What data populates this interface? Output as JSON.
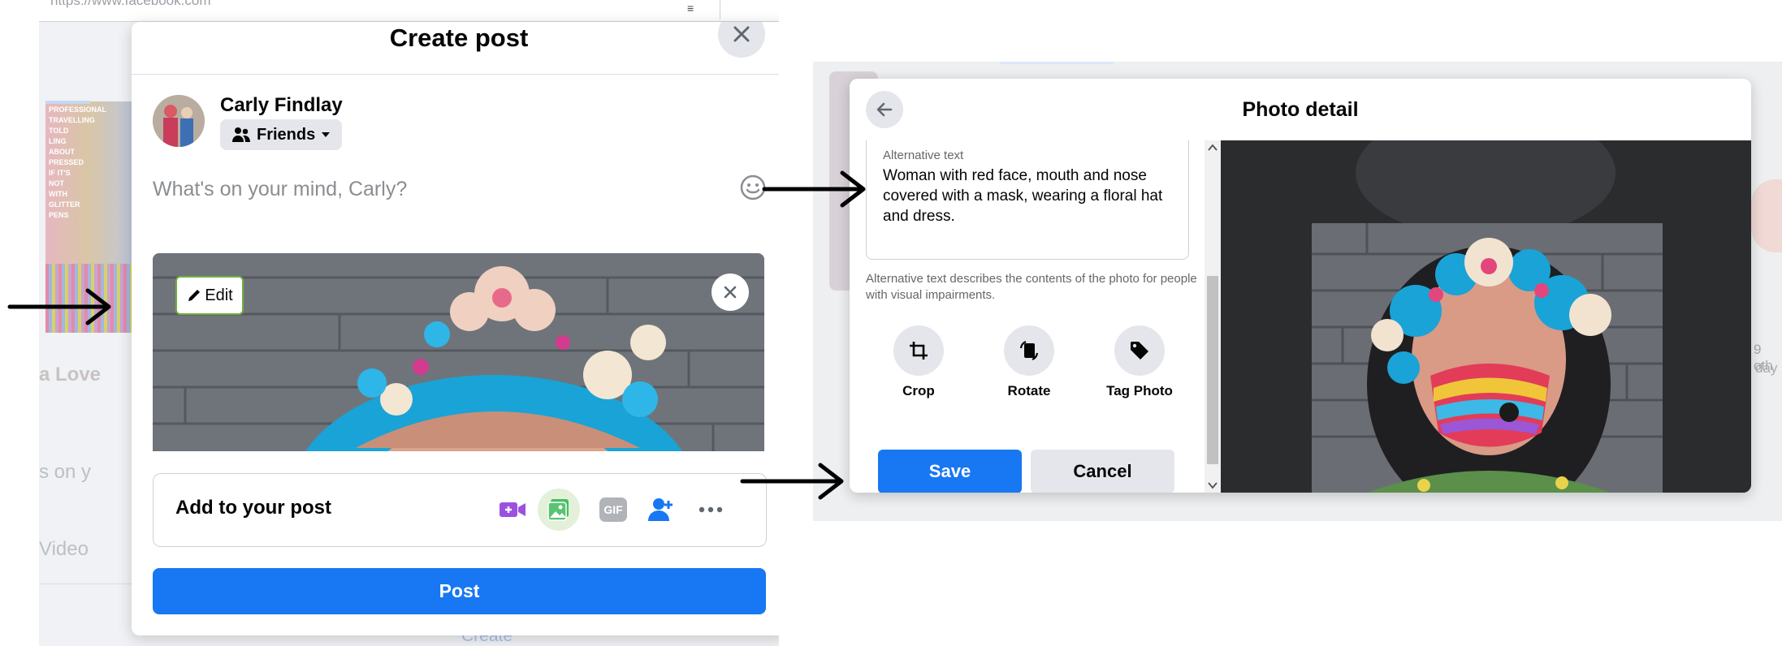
{
  "left": {
    "url": "https://www.facebook.com",
    "title": "Create post",
    "user_name": "Carly Findlay",
    "audience": "Friends",
    "composer_placeholder": "What's on your mind, Carly?",
    "edit_label": "Edit",
    "add_to_post_label": "Add to your post",
    "add_icons": [
      "video-icon",
      "photo-icon",
      "gif-icon",
      "tag-people-icon",
      "more-icon"
    ],
    "gif_text": "GIF",
    "post_label": "Post",
    "background": {
      "cover_words": [
        "PROFESSIONAL",
        "TRAVELLING",
        "TOLD",
        "LING ABOUT",
        "PRESSED",
        "IF IT'S NOT",
        "WITH GLITTER",
        "PENS"
      ],
      "label_a": "a Love",
      "label_b": "s on y",
      "label_c": "Video",
      "label_d": "Create"
    }
  },
  "right": {
    "title": "Photo detail",
    "alt_label": "Alternative text",
    "alt_value": "Woman with red face, mouth and nose covered with a mask, wearing a floral hat and dress.",
    "alt_help": "Alternative text describes the contents of the photo for people with visual impairments.",
    "tools": [
      {
        "label": "Crop",
        "icon": "crop-icon"
      },
      {
        "label": "Rotate",
        "icon": "rotate-icon"
      },
      {
        "label": "Tag Photo",
        "icon": "tag-icon"
      }
    ],
    "save_label": "Save",
    "cancel_label": "Cancel",
    "background": {
      "label_a": "9 oth",
      "label_b": "day"
    }
  },
  "annotations": [
    "arrow-to-edit",
    "arrow-to-alt-text",
    "arrow-to-save"
  ],
  "colors": {
    "primary": "#1877f2",
    "edit_border": "#6fb03e",
    "arrow": "#000000"
  }
}
